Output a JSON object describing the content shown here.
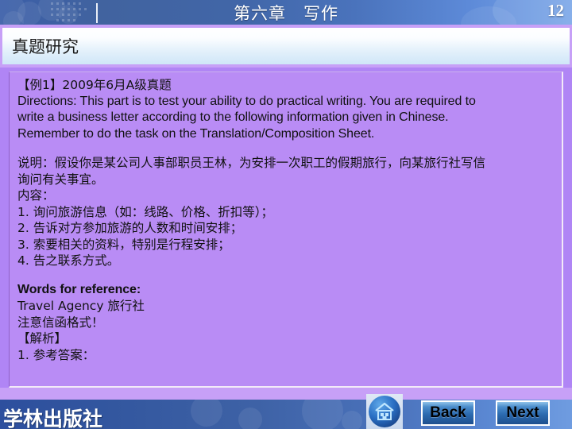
{
  "header": {
    "title": "第六章　写作",
    "page_number": "12"
  },
  "section": {
    "title": "真题研究"
  },
  "content": {
    "lines": [
      {
        "text": "【例1】2009年6月A级真题",
        "style": "cn"
      },
      {
        "text": "Directions: This part is to test your ability to do practical writing. You are required to",
        "style": "en"
      },
      {
        "text": "write a business letter according to the following information given in Chinese.",
        "style": "en"
      },
      {
        "text": "Remember to do the task on the Translation/Composition Sheet.",
        "style": "en"
      },
      {
        "text": "",
        "style": "spacer"
      },
      {
        "text": "说明：假设你是某公司人事部职员王林，为安排一次职工的假期旅行，向某旅行社写信",
        "style": "cn"
      },
      {
        "text": "询问有关事宜。",
        "style": "cn"
      },
      {
        "text": "内容：",
        "style": "cn"
      },
      {
        "text": "1. 询问旅游信息（如：线路、价格、折扣等）；",
        "style": "cn"
      },
      {
        "text": "2. 告诉对方参加旅游的人数和时间安排；",
        "style": "cn"
      },
      {
        "text": "3. 索要相关的资料，特别是行程安排；",
        "style": "cn"
      },
      {
        "text": "4. 告之联系方式。",
        "style": "cn"
      },
      {
        "text": "",
        "style": "spacer"
      },
      {
        "text": "Words for reference:",
        "style": "en-bold"
      },
      {
        "text": "Travel Agency 旅行社",
        "style": "cn"
      },
      {
        "text": "注意信函格式！",
        "style": "cn"
      },
      {
        "text": "【解析】",
        "style": "cn"
      },
      {
        "text": "1. 参考答案：",
        "style": "cn"
      }
    ]
  },
  "footer": {
    "brand": "学林出版社",
    "home_label": "home-icon",
    "back_label": "Back",
    "next_label": "Next"
  },
  "colors": {
    "panel_bg": "#b98cf5",
    "accent_purple": "#c7a0f7",
    "header_blue": "#3b5ea8",
    "button_blue": "#2c6bb0"
  }
}
